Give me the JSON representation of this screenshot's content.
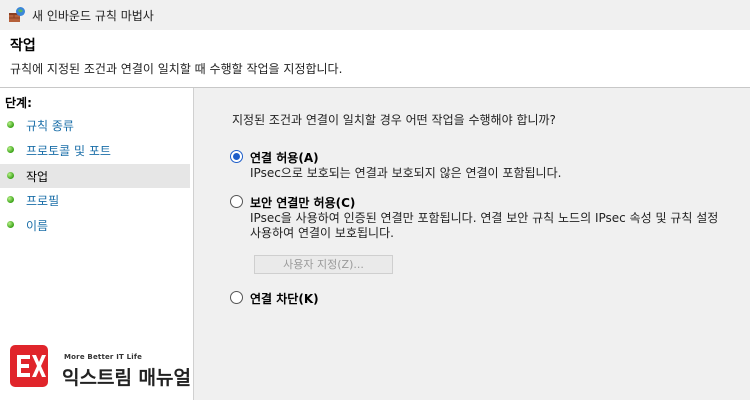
{
  "window": {
    "title": "새 인바운드 규칙 마법사"
  },
  "header": {
    "title": "작업",
    "description": "규칙에 지정된 조건과 연결이 일치할 때 수행할 작업을 지정합니다."
  },
  "sidebar": {
    "steps_label": "단계:",
    "items": [
      {
        "label": "규칙 종류"
      },
      {
        "label": "프로토콜 및 포트"
      },
      {
        "label": "작업"
      },
      {
        "label": "프로필"
      },
      {
        "label": "이름"
      }
    ],
    "selected_index": 2
  },
  "main": {
    "question": "지정된 조건과 연결이 일치할 경우 어떤 작업을 수행해야 합니까?",
    "options": [
      {
        "label": "연결 허용(A)",
        "description": "IPsec으로 보호되는 연결과 보호되지 않은 연결이 포함됩니다.",
        "selected": true
      },
      {
        "label": "보안 연결만 허용(C)",
        "description_line1": "IPsec을 사용하여 인증된 연결만 포함됩니다. 연결 보안 규칙 노드의 IPsec 속성 및 규칙 설정",
        "description_line2": "사용하여 연결이 보호됩니다.",
        "selected": false
      },
      {
        "label": "연결 차단(K)",
        "selected": false
      }
    ],
    "customize_button": "사용자 지정(Z)..."
  },
  "watermark": {
    "tagline": "More Better IT Life",
    "name": "익스트림 매뉴얼"
  },
  "colors": {
    "accent": "#1e5ec9",
    "link": "#1a6ea8",
    "logo_red": "#e0252b",
    "step_dot": "#3aa317"
  }
}
